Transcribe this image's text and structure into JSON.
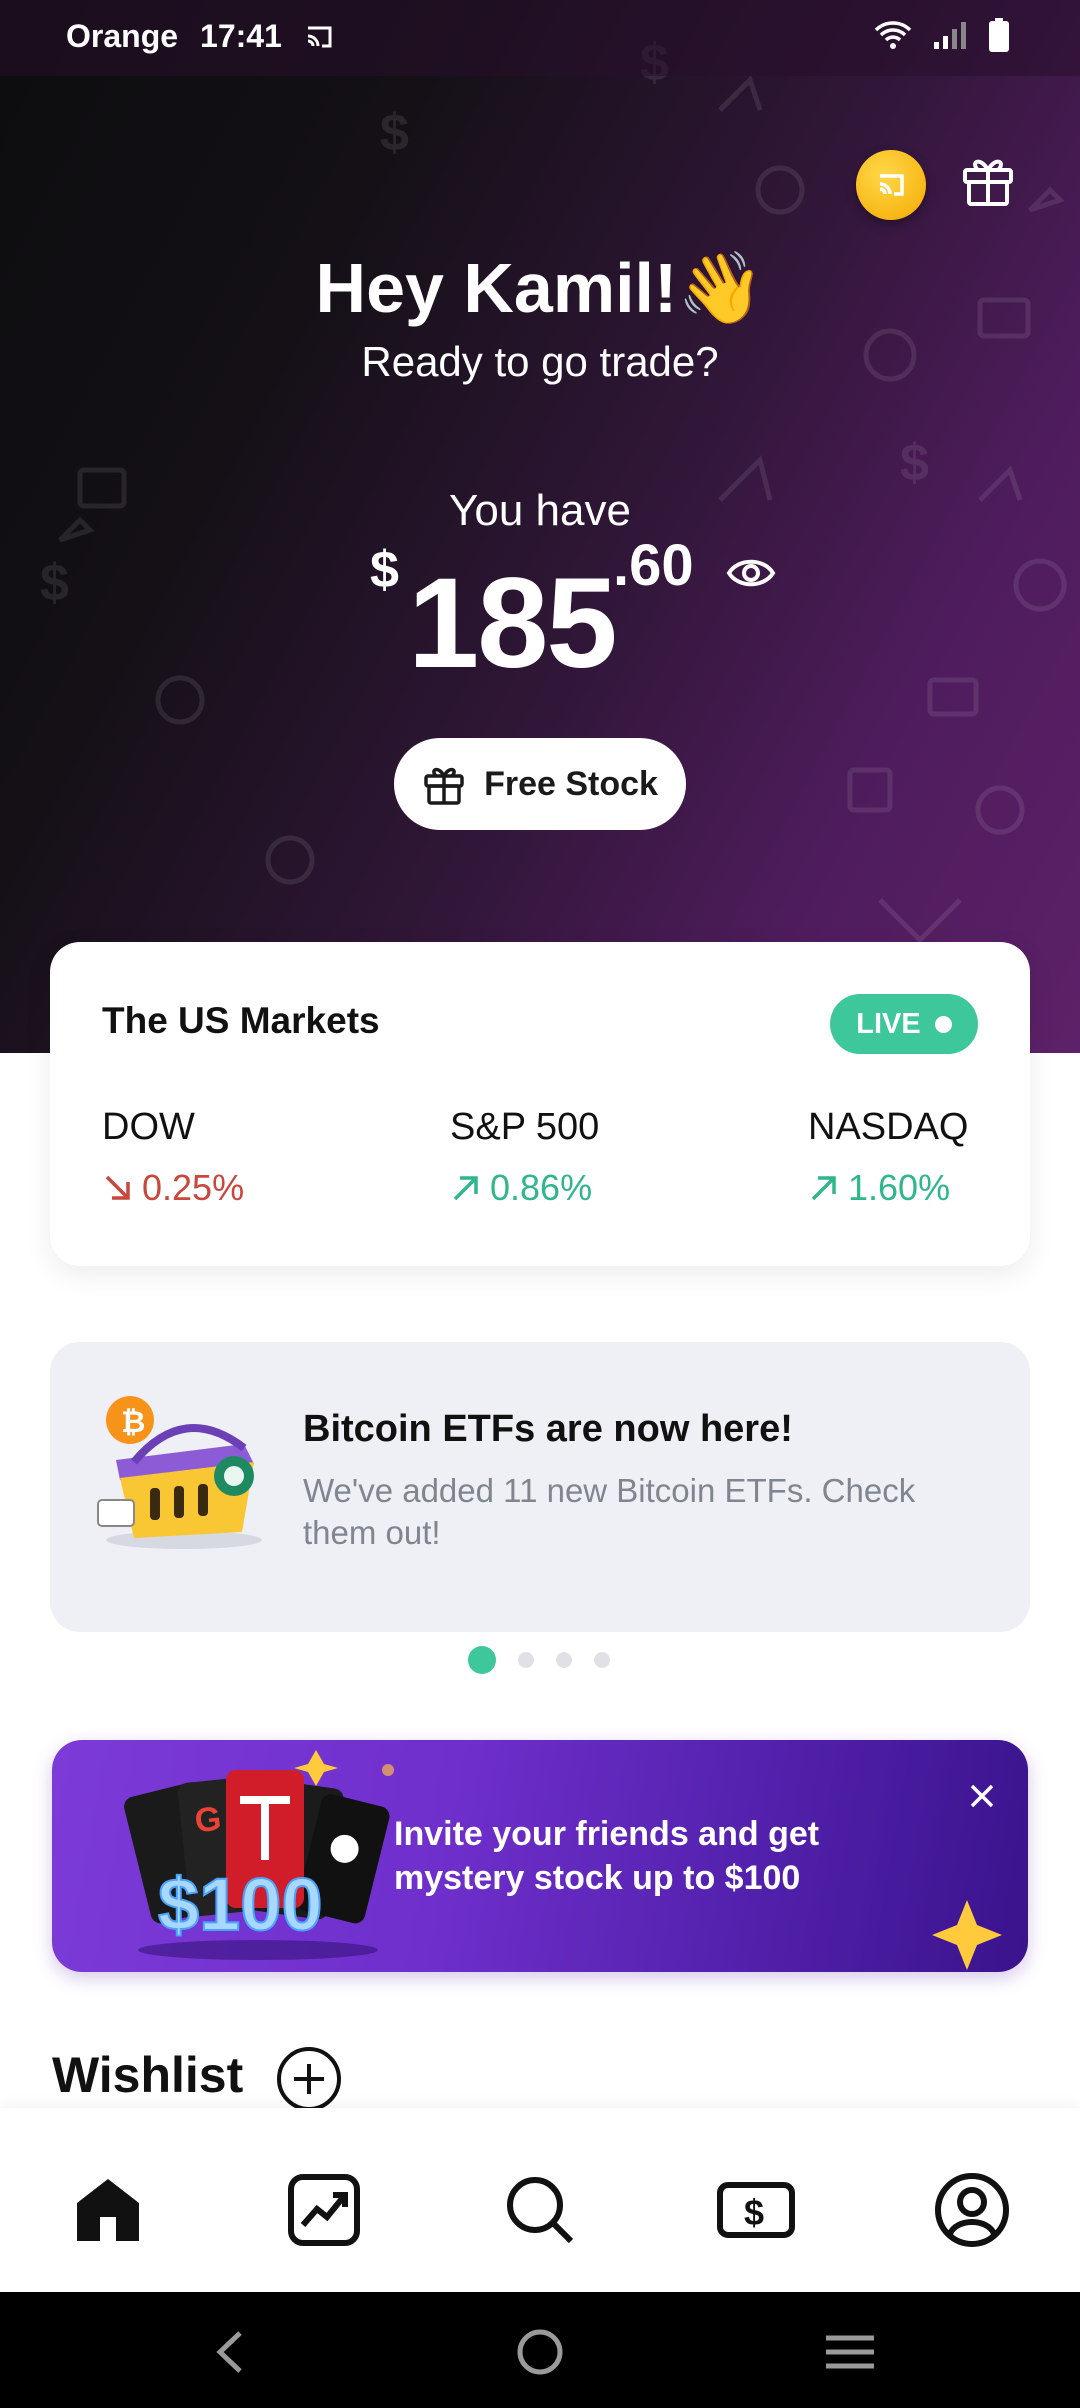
{
  "status_bar": {
    "carrier": "Orange",
    "time": "17:41"
  },
  "header": {
    "greeting": "Hey Kamil!👋",
    "subgreeting": "Ready to go trade?",
    "balance_label": "You have",
    "balance_currency": "$",
    "balance_integer": "185",
    "balance_decimal": ".60",
    "free_stock_label": "Free Stock"
  },
  "markets": {
    "title": "The US Markets",
    "live_label": "LIVE",
    "indices": [
      {
        "name": "DOW",
        "change": "0.25%",
        "direction": "down"
      },
      {
        "name": "S&P 500",
        "change": "0.86%",
        "direction": "up"
      },
      {
        "name": "NASDAQ",
        "change": "1.60%",
        "direction": "up"
      }
    ]
  },
  "news": {
    "title": "Bitcoin ETFs are now here!",
    "body": "We've added 11 new Bitcoin ETFs. Check them out!",
    "page_count": 4,
    "active_page": 1
  },
  "invite": {
    "text": "Invite your friends and get mystery stock up to $100",
    "illustration_amount": "$100"
  },
  "wishlist": {
    "title": "Wishlist"
  },
  "bottom_nav": {
    "items": [
      "home-icon",
      "portfolio-chart-icon",
      "search-icon",
      "cash-icon",
      "profile-icon"
    ],
    "active": "home-icon"
  },
  "colors": {
    "accent_green": "#3dc79a",
    "negative_red": "#c9473d",
    "invite_purple": "#6f2fcc"
  }
}
